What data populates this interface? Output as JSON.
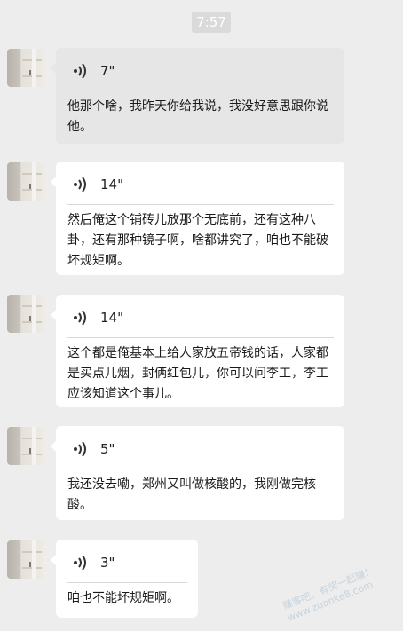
{
  "timestamp": "7:57",
  "messages": [
    {
      "duration": "7\"",
      "text": "他那个啥，我昨天你给我说，我没好意思跟你说他。"
    },
    {
      "duration": "14\"",
      "text": "然后俺这个铺砖儿放那个无底前，还有这种八卦，还有那种镜子啊，啥都讲究了，咱也不能破坏规矩啊。"
    },
    {
      "duration": "14\"",
      "text": "这个都是俺基本上给人家放五帝钱的话，人家都是买点儿烟，封俩红包儿，你可以问李工，李工应该知道这个事儿。"
    },
    {
      "duration": "5\"",
      "text": "我还没去嘞，郑州又叫做核酸的，我刚做完核酸。"
    },
    {
      "duration": "3\"",
      "text": "咱也不能坏规矩啊。"
    }
  ],
  "watermark": {
    "line1": "赚客吧，有奖一起赚！",
    "line2": "www.zuanke8.com"
  },
  "icons": {
    "voice": "voice-wave-icon",
    "avatar": "avatar-image"
  }
}
